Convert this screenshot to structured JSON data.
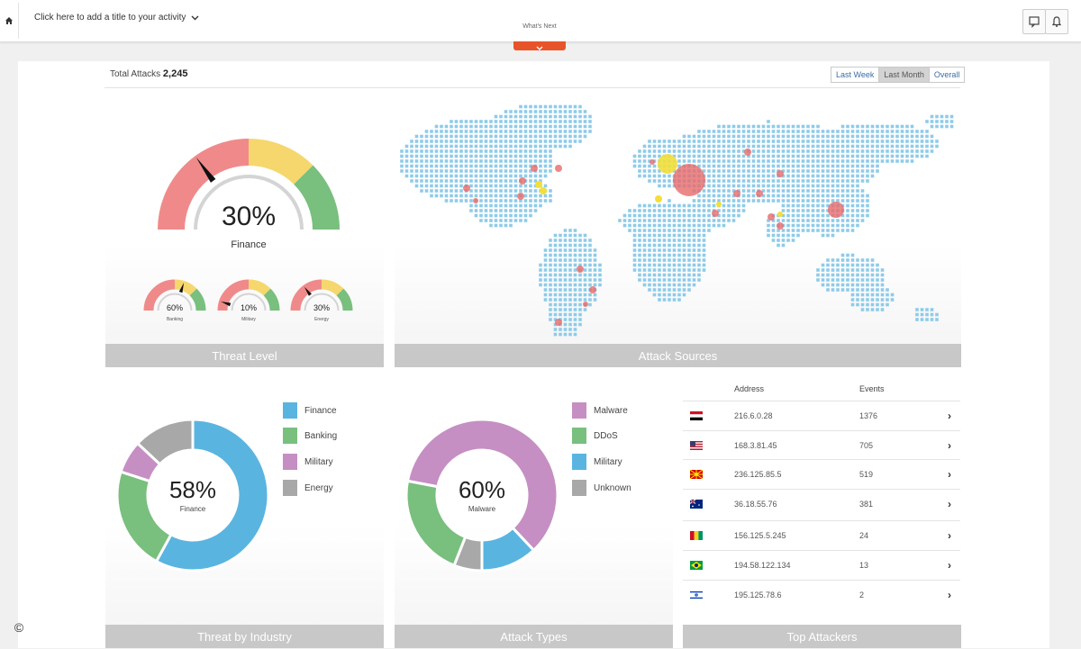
{
  "topbar": {
    "activity_title": "Click here to add a title to your activity",
    "whats_next": "What's Next"
  },
  "header": {
    "total_label": "Total Attacks",
    "total_value": "2,245",
    "ranges": [
      "Last Week",
      "Last Month",
      "Overall"
    ],
    "active_range": "Last Month"
  },
  "threat_level": {
    "title": "Threat Level",
    "main": {
      "percent": 30,
      "label": "30%",
      "name": "Finance"
    },
    "small": [
      {
        "percent": 60,
        "label": "60%",
        "name": "Banking"
      },
      {
        "percent": 10,
        "label": "10%",
        "name": "Military"
      },
      {
        "percent": 30,
        "label": "30%",
        "name": "Energy"
      }
    ]
  },
  "attack_sources": {
    "title": "Attack Sources"
  },
  "threat_by_industry": {
    "title": "Threat by Industry",
    "center_value": "58%",
    "center_label": "Finance",
    "legend": [
      "Finance",
      "Banking",
      "Military",
      "Energy"
    ]
  },
  "attack_types": {
    "title": "Attack Types",
    "center_value": "60%",
    "center_label": "Malware",
    "legend": [
      "Malware",
      "DDoS",
      "Military",
      "Unknown"
    ]
  },
  "top_attackers": {
    "title": "Top Attackers",
    "col_address": "Address",
    "col_events": "Events",
    "rows": [
      {
        "flag": "yemen-flag-icon",
        "address": "216.6.0.28",
        "events": "1376"
      },
      {
        "flag": "usa-flag-icon",
        "address": "168.3.81.45",
        "events": "705"
      },
      {
        "flag": "macedonia-flag-icon",
        "address": "236.125.85.5",
        "events": "519"
      },
      {
        "flag": "australia-flag-icon",
        "address": "36.18.55.76",
        "events": "381"
      },
      {
        "flag": "guinea-flag-icon",
        "address": "156.125.5.245",
        "events": "24"
      },
      {
        "flag": "brazil-flag-icon",
        "address": "194.58.122.134",
        "events": "13"
      },
      {
        "flag": "israel-flag-icon",
        "address": "195.125.78.6",
        "events": "2"
      }
    ]
  },
  "colors": {
    "finance": "#5ab4e0",
    "banking": "#79bf7e",
    "military": "#c58fc3",
    "energy": "#a8a8a8",
    "gauge_red": "#f08a8a",
    "gauge_yellow": "#f5d76e",
    "gauge_green": "#79bf7e",
    "map_dot": "#8ecbe9",
    "accent_orange": "#e8542a"
  },
  "chart_data": [
    {
      "type": "gauge",
      "title": "Threat Level",
      "values": [
        {
          "name": "Finance",
          "value": 30
        },
        {
          "name": "Banking",
          "value": 60
        },
        {
          "name": "Military",
          "value": 10
        },
        {
          "name": "Energy",
          "value": 30
        }
      ]
    },
    {
      "type": "pie",
      "title": "Threat by Industry",
      "categories": [
        "Finance",
        "Banking",
        "Military",
        "Energy"
      ],
      "values": [
        58,
        22,
        7,
        13
      ]
    },
    {
      "type": "pie",
      "title": "Attack Types",
      "categories": [
        "Malware",
        "DDoS",
        "Military",
        "Unknown"
      ],
      "values": [
        60,
        22,
        12,
        6
      ]
    }
  ]
}
